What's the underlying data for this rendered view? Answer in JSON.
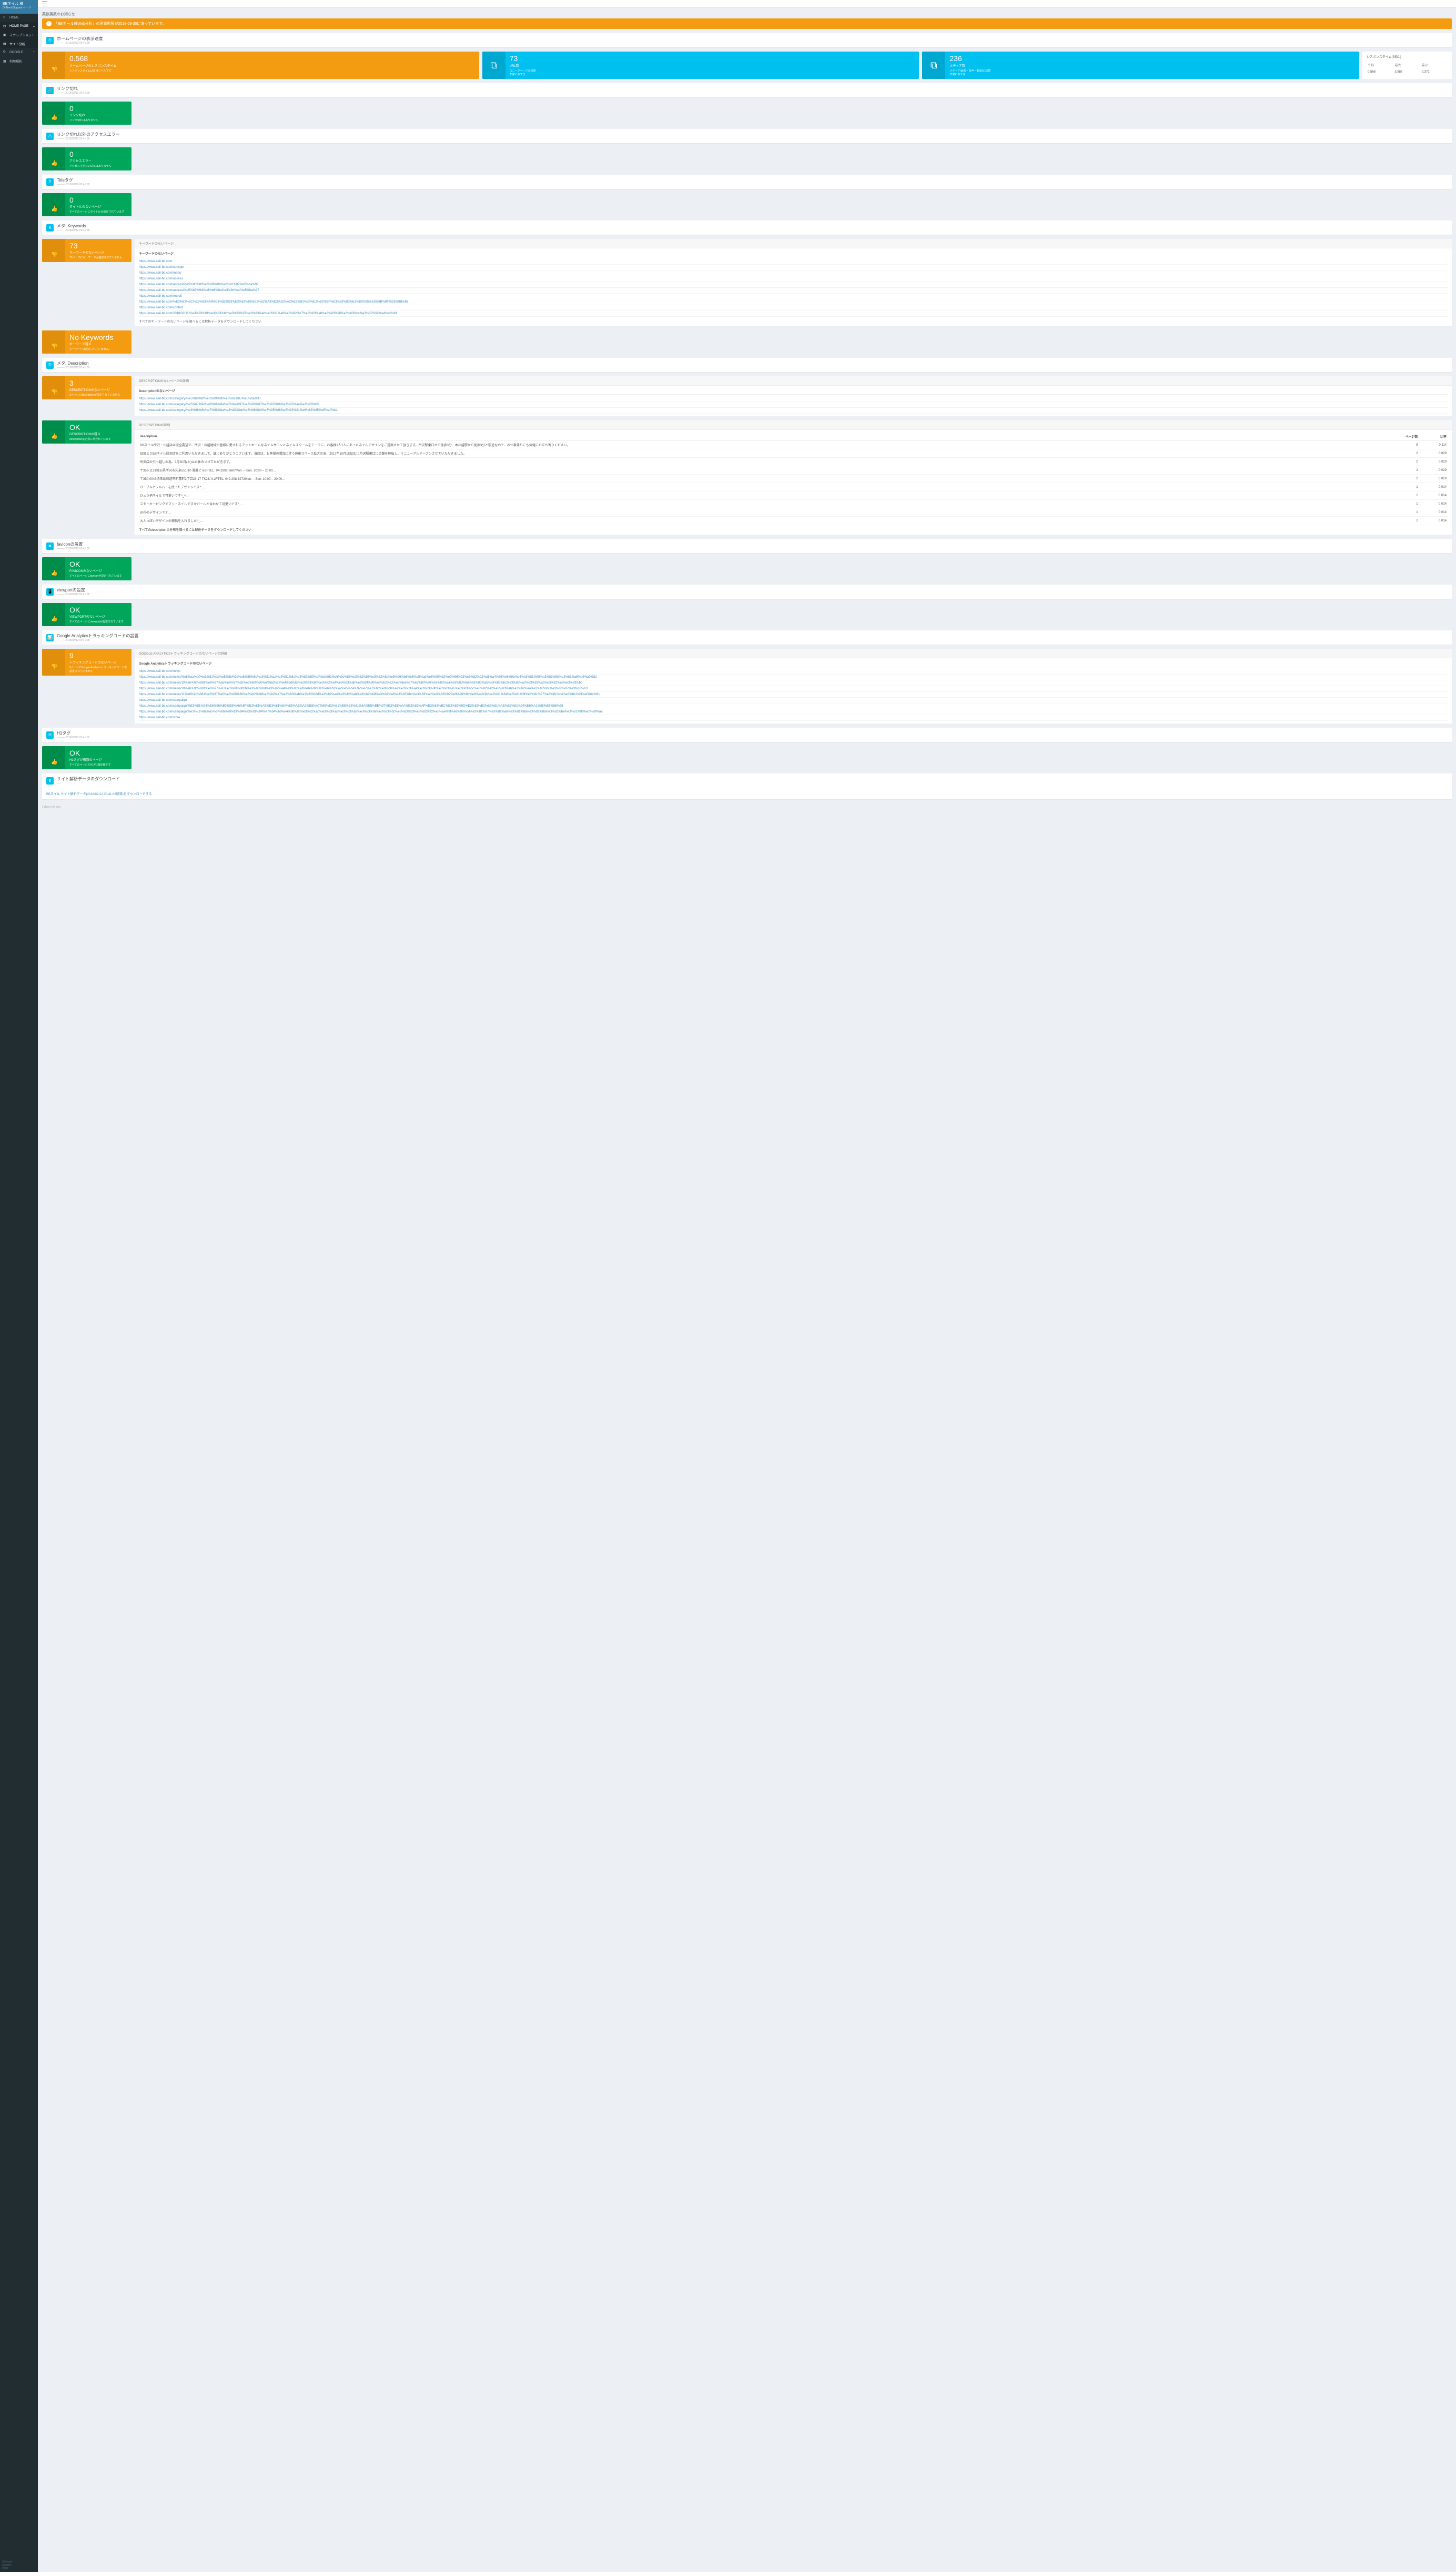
{
  "brand": {
    "title": "BBネイル 様",
    "sub": "OhNeed Support ページ"
  },
  "nav": [
    {
      "icon": "home",
      "label": "HOME"
    },
    {
      "icon": "clock",
      "label": "HOME PAGE",
      "caret": "▾",
      "active": true
    },
    {
      "icon": "camera",
      "label": "スナップショット",
      "dark": true
    },
    {
      "icon": "chart",
      "label": "サイト分析",
      "dark": true,
      "active": true
    },
    {
      "icon": "google",
      "label": "GOOGLE",
      "caret": "+",
      "dark": false
    },
    {
      "icon": "doc",
      "label": "利用規約"
    }
  ],
  "sidebarFooter": {
    "l1": "OhNeed",
    "l2": "Support",
    "l3": "Page"
  },
  "alertsTitle": "英数英数のお知らせ",
  "alert": {
    "badge": "!",
    "text": "「BBネール様Web分析」の更新期限が2018-03-30に迫っています。"
  },
  "sections": {
    "speed": {
      "title": "ホームページの表示速度",
      "sub": "——— 2018/02/12 00:41:08"
    },
    "linkBroken": {
      "title": "リンク切れ",
      "sub": "——— 2018/02/12 00:41:08"
    },
    "accessError": {
      "title": "リンク切れ以外のアクセスエラー",
      "sub": "——— 2018/02/12 00:41:08"
    },
    "titleTag": {
      "title": "Titleタグ",
      "sub": "——— 2018/02/12 00:41:08"
    },
    "keywords": {
      "title": "メタ: Keywords",
      "sub": "——— 2018/02/12 00:41:08"
    },
    "description": {
      "title": "メタ: Description",
      "sub": "——— 2018/02/12 00:41:08"
    },
    "favicon": {
      "title": "faviconの設置",
      "sub": "——— 2018/02/12 00:41:08"
    },
    "viewport": {
      "title": "viewportの設定",
      "sub": "——— 2018/02/12 00:41:08"
    },
    "ga": {
      "title": "Google Analyticsトラッキングコードの設置",
      "sub": "——— 2018/02/12 00:41:08"
    },
    "h1": {
      "title": "H1タグ",
      "sub": "——— 2018/02/12 00:41:08"
    },
    "download": {
      "title": "サイト解析データのダウンロード",
      "sub": "——"
    }
  },
  "speedBoxes": [
    {
      "num": "0.568",
      "label": "ホームページのレスポンスタイム",
      "sub": "レスポンスタイムは妥当レベルです",
      "color": "yellow",
      "icon": "down"
    },
    {
      "num": "73",
      "label": "URL数",
      "sub": "ユニークページの総数\n非常に多すぎ",
      "color": "aqua",
      "icon": "sitemap"
    },
    {
      "num": "236",
      "label": "メディア数",
      "sub": "メディア(画像・音声・動画)の総数\n非常に多すぎ",
      "color": "aqua",
      "icon": "sitemap"
    }
  ],
  "respTable": {
    "title": "レスポンスタイム(SEC.)",
    "headers": [
      "平均",
      "最大",
      "最小"
    ],
    "row": [
      "0.568",
      "3.587",
      "0.371"
    ]
  },
  "linkBrokenBox": {
    "num": "0",
    "label": "リンク切れ",
    "sub": "リンク切れはありません"
  },
  "accessErrorBox": {
    "num": "0",
    "label": "アクセスエラー",
    "sub": "アクセスできないURLはありません"
  },
  "titleBox": {
    "num": "0",
    "label": "タイトルのないページ",
    "sub": "すべてのページにタイトルが設定されています"
  },
  "keywordsBox": {
    "num": "73",
    "label": "キーワードのないページ",
    "sub": "73ページにキーワードが設定されていません"
  },
  "noKeywordsBox": {
    "num": "No Keywords",
    "label": "キーワード種 0",
    "sub": "キーワードは設定されていません。"
  },
  "keywordsDetail": {
    "header": "キーワードのないページ",
    "sub": "キーワードのないページ",
    "links": [
      "https://www.nail-bb.com",
      "https://www.nail-bb.com/concept",
      "https://www.nail-bb.com/menu",
      "https://www.nail-bb.com/access",
      "https://www.nail-bb.com/access/%e5%b0%8f%e6%89%8b%e6%8c%87%e5%ba%97",
      "https://www.nail-bb.com/access/%e5%b7%9d%e8%b6%8a%e6%9c%ac%e5%ba%97",
      "https://www.nail-bb.com/recruit",
      "https://www.nail-bb.com/%E3%83%9C%E3%83%A9%E3%83%B3%E3%83%86%E3%82%A3%E3%82%A2%E3%82%B9%E3%82%BF%E3%83%83%E3%83%95%E5%8B%9F%E9%9B%86",
      "https://www.nail-bb.com/contact",
      "https://www.nail-bb.com/2018/02/11/%e3%83%91%e3%83%bc%e3%83%97%e3%83%ab%e3%81%a8%e3%82%b7%e3%83%ab%e3%83%90%e3%83%bc%e3%82%92%e4%bd%bf"
    ],
    "note": "すべてのキーワードのないページを調べるには解析データをダウンロードしてください"
  },
  "descBox": {
    "num": "3",
    "label": "DESCRIPTIONのないページ",
    "sub": "3ページにdescriptionが設定されていません"
  },
  "descDetail": {
    "header": "DESCRIPTIONのないページの詳細",
    "sub": "Descriptionのないページ",
    "links": [
      "https://www.nail-bb.com/category/%e5%b0%8f%e6%89%8b%e6%8c%87%e5%ba%97",
      "https://www.nail-bb.com/category/%e5%b7%9d%e8%b6%8a%e5%ba%97%e3%83%87%e3%82%b6%e3%82%a4%e3%83%b3",
      "https://www.nail-bb.com/category/%e9%96%8b%e7%99%ba%e3%83%bb%e6%96%b0%e5%95%86%e5%93%81%e6%83%85%e5%a0%b1"
    ]
  },
  "descOkBox": {
    "num": "OK",
    "label": "DESCRIPTIONの種 3",
    "sub": "descriptionは正常に分かれています"
  },
  "descOkDetail": {
    "header": "DESCRIPTIONの詳細",
    "th": [
      "description",
      "ページ数",
      "比率"
    ],
    "rows": [
      [
        "BBネイル所沢・川越店は完全要望で、所沢・川越地域の皆様に愛されるアットホームなネイルサロンとネイルスクールをテーマに、お客様1人1人にあったネイルデザインをご提案させて頂きます。所沢駅東口から徒歩3分、本川越駅から徒歩3分と駅近なので、お仕事帰りにも気軽にお立ち寄りください。",
        "8",
        "0.114"
      ],
      [
        "日頃よりBBネイル所沢店をご利用いただきまして、誠にありがとうございます。当店は、お客様の増加に伴う施術スペース拡大の為、2017年10月1日(日)に所沢駅東口に店舗を移転し、リニューアルオープンさせていただきました。",
        "2",
        "0.029"
      ],
      [
        "所沢店の引っ越しの為、9月30日(土)はお休みさせてただきます。",
        "2",
        "0.029"
      ],
      [
        "〒359-1131埼玉県所沢市久米551-10 湯藤ビル3FTEL: 04-2902-6687Mon. – Sun. 10:00 – 20:00…",
        "2",
        "0.029"
      ],
      [
        "〒350-0043埼玉県川越市新富町2丁目23-17 TK2ビル2FTEL: 049-298-6272Mon. – Sun. 10:00 – 20:00…",
        "2",
        "0.029"
      ],
      [
        "パープルとシルバーを使ったデザインです^_…",
        "1",
        "0.014"
      ],
      [
        "ひょう柄ネイルで可愛いです^_^…",
        "1",
        "0.014"
      ],
      [
        "スモーキーピンクでマットネイルですがパールと合わせて可愛いです^_…",
        "1",
        "0.014"
      ],
      [
        "お花のデザインです…",
        "1",
        "0.014"
      ],
      [
        "大人っぽいデザインの親指を入れました^_…",
        "1",
        "0.014"
      ]
    ],
    "note": "すべてのdescriptionの分布を調べるには解析データをダウンロードしてください"
  },
  "faviconBox": {
    "num": "OK",
    "label": "FAVICONのないページ",
    "sub": "すべてのページにfaviconが設定されています"
  },
  "viewportBox": {
    "num": "OK",
    "label": "VIEWPORTのないページ",
    "sub": "すべてのページにviewportが設定されています"
  },
  "gaBox": {
    "num": "9",
    "label": "トラッキングコードのないページ",
    "sub": "9ページにGoogle Analyticsトラッキングコードを設定されていません"
  },
  "gaDetail": {
    "header": "GOOGLE ANALYTICSトラッキングコードのないページの詳細",
    "sub": "Google Analyticsトラッキングコードのないページ",
    "links": [
      "https://www.nail-bb.com/news",
      "https://www.nail-bb.com/news/%e8%aa%a0%e3%81%ab%e5%8b%9d%e6%89%8b%e3%81%aa%e3%81%8c%e3%82%89%ef%bc%91%e6%9c%88%e3%82%88%e3%82%8a%e5%96%b6%e6%a5%ad%e6%99%82%e9%96%93%e3%82%92%e5%a4%89%e6%9b%b4%e3%81%95%e3%81%9b%e3%81%a6%e9%a0%82",
      "https://www.nail-bb.com/news/10%e6%9c%881%e6%97%a5%e6%97%a5%e3%80%80%ef%bd%82%ef%bd%82%e3%83%8d%e3%82%a4%e3%83%ab%e6%89%80%e6%b2%a2%e5%ba%97%e3%80%80%e3%83%aa%e3%83%8b%e3%83%a5%e3%83%bc%e3%82%a2%e3%83%ab%e3%82%aa%e3%83%bc",
      "https://www.nail-bb.com/news/10%e6%9c%881%e6%97%a5%e3%80%80bb%e3%83%8d%e3%82%a4%e3%83%ab%e6%89%80%e6%b2%a2%e5%ba%97%e7%a7%bb%e8%bb%a2%e3%83%aa%e3%83%8b%e3%83%a5%e3%83%bc%e3%82%a2%e3%83%ab%e3%82%aa%e3%83%bc%e3%83%97%e3%83%b3",
      "https://www.nail-bb.com/news/11%e6%9c%881%e6%97%a5%e3%80%80%e3%82%b8%e3%82%a7%e3%83%ab%e3%83%8d%e3%82%a4%e3%83%ab%e3%82%b9%e3%82%af%e3%83%bc%e3%83%ab%e3%82%92%e9%96%8b%e8%ac%9b%e3%81%84%e3%81%9f%e3%81%97%e3%81%be%e3%81%99%ef%bc%81",
      "https://www.nail-bb.com/campaign",
      "https://www.nail-bb.com/campaign/%E3%81%94%E6%96%B0%E8%A6%8F%E3%81%AE%E3%81%8A%E5%AE%A2%E6%A7%98%E3%81%B8%E3%81%8A%E5%BE%97%E3%81%AA%E3%82%AF%E3%83%BC%E3%83%9D%E3%83%B3%E3%81%AE%E3%81%94%E6%A1%88%E5%86%85",
      "https://www.nail-bb.com/campaign/%e3%81%8a%e5%8f%8b%e9%81%94%e3%81%94%e7%b4%b9%e4%bb%8b%e3%82%ad%e3%83%a3%e3%83%b3%e3%83%9a%e3%83%bc%e3%83%b3%e3%82%92%e5%ae%9f%e6%96%bd%e3%81%97%e3%81%a6%e3%81%8a%e3%82%8a%e3%81%be%e3%81%99%e2%99%aa",
      "https://www.nail-bb.com/store"
    ]
  },
  "h1Box": {
    "num": "OK",
    "label": "H1タグが複数のページ",
    "sub": "すべてのページでH1が1個定義です"
  },
  "downloadLink": "BBネイル サイト解析データ(2018/02/12 00:41:08取得)をダウンロードする",
  "footerBrand": "Ohneed Inc."
}
